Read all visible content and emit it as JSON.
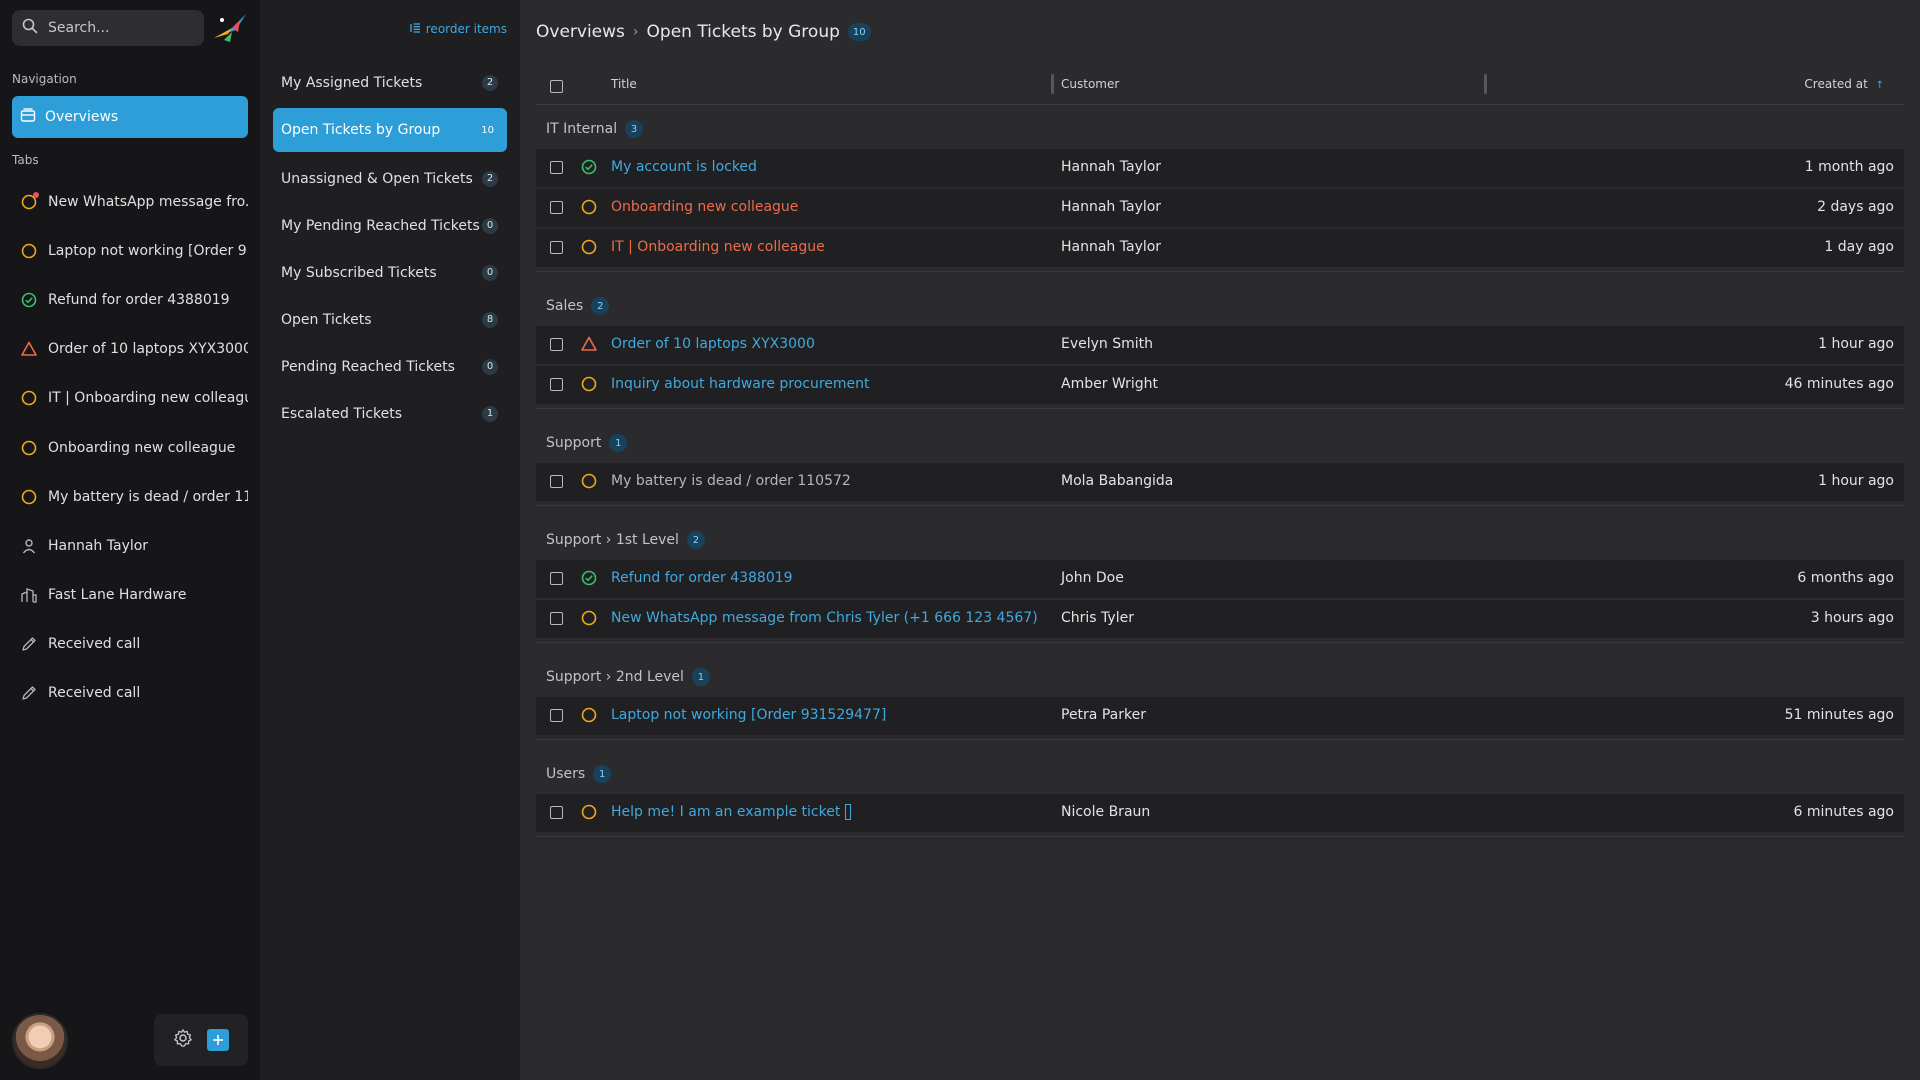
{
  "search": {
    "placeholder": "Search..."
  },
  "sidebar": {
    "navigation_label": "Navigation",
    "overviews_label": "Overviews",
    "tabs_label": "Tabs",
    "tabs": [
      {
        "label": "New WhatsApp message fro...",
        "icon": "circle-open-icon",
        "color": "#f0a81f",
        "unread": true
      },
      {
        "label": "Laptop not working [Order 9...",
        "icon": "circle-open-icon",
        "color": "#f0a81f"
      },
      {
        "label": "Refund for order 4388019",
        "icon": "check-circle-icon",
        "color": "#3bbf6a"
      },
      {
        "label": "Order of 10 laptops XYX3000",
        "icon": "warning-triangle-icon",
        "color": "#ef6a4b"
      },
      {
        "label": "IT | Onboarding new colleague",
        "icon": "circle-open-icon",
        "color": "#f0a81f"
      },
      {
        "label": "Onboarding new colleague",
        "icon": "circle-open-icon",
        "color": "#f0a81f"
      },
      {
        "label": "My battery is dead / order 11...",
        "icon": "circle-open-icon",
        "color": "#f0a81f"
      },
      {
        "label": "Hannah Taylor",
        "icon": "user-icon",
        "color": "#b6b6b9"
      },
      {
        "label": "Fast Lane Hardware",
        "icon": "building-icon",
        "color": "#b6b6b9"
      },
      {
        "label": "Received call",
        "icon": "pencil-icon",
        "color": "#b6b6b9"
      },
      {
        "label": "Received call",
        "icon": "pencil-icon",
        "color": "#b6b6b9"
      }
    ]
  },
  "overview_list": {
    "reorder_label": "reorder items",
    "items": [
      {
        "label": "My Assigned Tickets",
        "count": "2"
      },
      {
        "label": "Open Tickets by Group",
        "count": "10",
        "active": true
      },
      {
        "label": "Unassigned & Open Tickets",
        "count": "2"
      },
      {
        "label": "My Pending Reached Tickets",
        "count": "0"
      },
      {
        "label": "My Subscribed Tickets",
        "count": "0"
      },
      {
        "label": "Open Tickets",
        "count": "8"
      },
      {
        "label": "Pending Reached Tickets",
        "count": "0"
      },
      {
        "label": "Escalated Tickets",
        "count": "1"
      }
    ]
  },
  "main": {
    "breadcrumb_root": "Overviews",
    "breadcrumb_current": "Open Tickets by Group",
    "total_count": "10",
    "columns": {
      "title": "Title",
      "customer": "Customer",
      "created": "Created at"
    },
    "groups": [
      {
        "name": "IT Internal",
        "count": "3",
        "rows": [
          {
            "title": "My account is locked",
            "customer": "Hannah Taylor",
            "created": "1 month ago",
            "state": "check",
            "title_color": "blue"
          },
          {
            "title": "Onboarding new colleague",
            "customer": "Hannah Taylor",
            "created": "2 days ago",
            "state": "open",
            "title_color": "red"
          },
          {
            "title": "IT | Onboarding new colleague",
            "customer": "Hannah Taylor",
            "created": "1 day ago",
            "state": "open",
            "title_color": "red"
          }
        ]
      },
      {
        "name": "Sales",
        "count": "2",
        "rows": [
          {
            "title": "Order of 10 laptops XYX3000",
            "customer": "Evelyn Smith",
            "created": "1 hour ago",
            "state": "warning",
            "title_color": "blue"
          },
          {
            "title": "Inquiry about hardware procurement",
            "customer": "Amber Wright",
            "created": "46 minutes ago",
            "state": "open",
            "title_color": "blue"
          }
        ]
      },
      {
        "name": "Support",
        "count": "1",
        "rows": [
          {
            "title": "My battery is dead / order 110572",
            "customer": "Mola Babangida",
            "created": "1 hour ago",
            "state": "open",
            "title_color": "grey"
          }
        ]
      },
      {
        "name": "Support › 1st Level",
        "count": "2",
        "rows": [
          {
            "title": "Refund for order 4388019",
            "customer": "John Doe",
            "created": "6 months ago",
            "state": "check",
            "title_color": "blue"
          },
          {
            "title": "New WhatsApp message from Chris Tyler (+1 666 123 4567)",
            "customer": "Chris Tyler",
            "created": "3 hours ago",
            "state": "open",
            "title_color": "blue"
          }
        ]
      },
      {
        "name": "Support › 2nd Level",
        "count": "1",
        "rows": [
          {
            "title": "Laptop not working [Order 931529477]",
            "customer": "Petra Parker",
            "created": "51 minutes ago",
            "state": "open",
            "title_color": "blue"
          }
        ]
      },
      {
        "name": "Users",
        "count": "1",
        "rows": [
          {
            "title": "Help me! I am an example ticket",
            "customer": "Nicole Braun",
            "created": "6 minutes ago",
            "state": "open",
            "title_color": "blue",
            "cursor": true
          }
        ]
      }
    ]
  },
  "colors": {
    "accent": "#2d9ed8",
    "link": "#3fa9e0",
    "open": "#f0a81f",
    "closed": "#3bbf6a",
    "escalated": "#ef6a4b"
  }
}
